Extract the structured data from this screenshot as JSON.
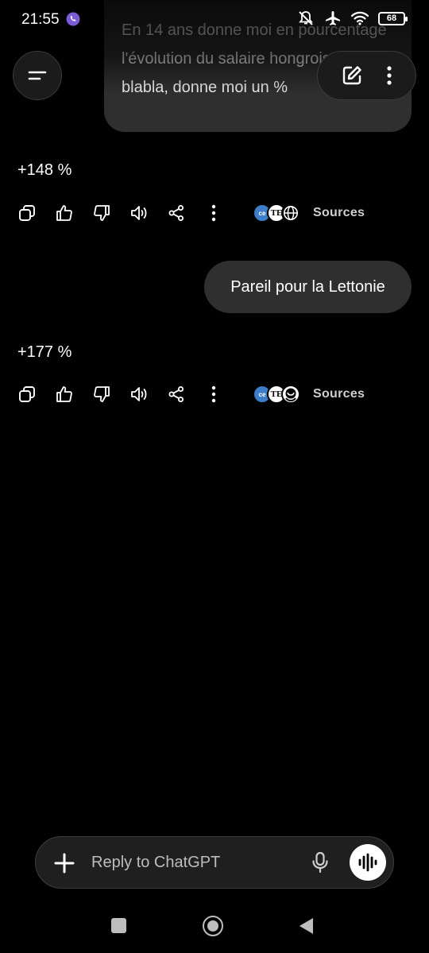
{
  "status_bar": {
    "time": "21:55",
    "battery": "68"
  },
  "conversation": {
    "user_message_1": "En 14 ans donne moi en pourcentage l'évolution du salaire hongrois. Pas de blabla, donne moi un %",
    "answer_1": "+148 %",
    "sources_label_1": "Sources",
    "user_message_2": "Pareil pour la Lettonie",
    "answer_2": "+177 %",
    "sources_label_2": "Sources"
  },
  "source_icons": {
    "ce": "ce",
    "te": "TE"
  },
  "composer": {
    "placeholder": "Reply to ChatGPT"
  },
  "icons": [
    "menu-icon",
    "new-chat-icon",
    "more-icon",
    "copy-icon",
    "thumbs-up-icon",
    "thumbs-down-icon",
    "read-aloud-icon",
    "share-icon",
    "more-vertical-icon",
    "plus-icon",
    "mic-icon",
    "voice-mode-icon"
  ],
  "colors": {
    "background": "#000000",
    "bubble": "#2f2f2f",
    "source_blue": "#3d7ec9"
  }
}
